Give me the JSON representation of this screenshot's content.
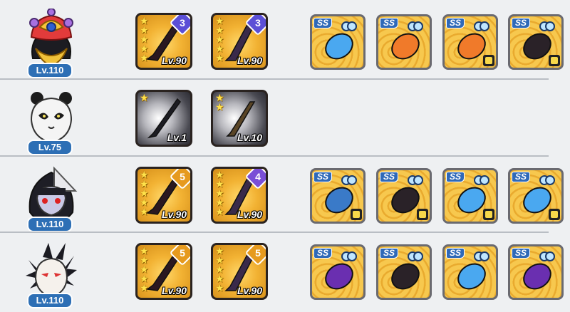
{
  "heroes": [
    {
      "name": "jester-hero",
      "level": "Lv.110",
      "weapons": [
        {
          "style": "gold",
          "stars": 5,
          "level": "Lv.90",
          "badge": "3",
          "badge_color": "#5b4fd6"
        },
        {
          "style": "gold",
          "stars": 5,
          "level": "Lv.90",
          "badge": "3",
          "badge_color": "#5b4fd6"
        }
      ],
      "equipment": [
        {
          "tier": "SS",
          "icon": "blue-drill-icon",
          "set_icon": false
        },
        {
          "tier": "SS",
          "icon": "fire-horn-icon",
          "set_icon": false
        },
        {
          "tier": "SS",
          "icon": "horn-bracer-icon",
          "set_icon": true
        },
        {
          "tier": "SS",
          "icon": "spiked-crown-icon",
          "set_icon": true
        }
      ]
    },
    {
      "name": "panda-hero",
      "level": "Lv.75",
      "weapons": [
        {
          "style": "grey",
          "stars": 1,
          "level": "Lv.1",
          "badge": "",
          "badge_color": ""
        },
        {
          "style": "grey",
          "stars": 2,
          "level": "Lv.10",
          "badge": "",
          "badge_color": ""
        }
      ],
      "equipment": []
    },
    {
      "name": "ninja-girl-hero",
      "level": "Lv.110",
      "weapons": [
        {
          "style": "gold",
          "stars": 5,
          "level": "Lv.90",
          "badge": "5",
          "badge_color": "#e69a1e"
        },
        {
          "style": "gold",
          "stars": 5,
          "level": "Lv.90",
          "badge": "4",
          "badge_color": "#7a4fd6"
        }
      ],
      "equipment": [
        {
          "tier": "SS",
          "icon": "fan-icon",
          "set_icon": true
        },
        {
          "tier": "SS",
          "icon": "dark-bracer-icon",
          "set_icon": true
        },
        {
          "tier": "SS",
          "icon": "mirror-icon",
          "set_icon": true
        },
        {
          "tier": "SS",
          "icon": "blue-drill-icon",
          "set_icon": true
        }
      ]
    },
    {
      "name": "fox-hero",
      "level": "Lv.110",
      "weapons": [
        {
          "style": "gold",
          "stars": 5,
          "level": "Lv.90",
          "badge": "5",
          "badge_color": "#e69a1e"
        },
        {
          "style": "gold",
          "stars": 5,
          "level": "Lv.90",
          "badge": "5",
          "badge_color": "#e69a1e"
        }
      ],
      "equipment": [
        {
          "tier": "SS",
          "icon": "purple-ring-icon",
          "set_icon": false
        },
        {
          "tier": "SS",
          "icon": "dark-vial-icon",
          "set_icon": false
        },
        {
          "tier": "SS",
          "icon": "blue-claw-icon",
          "set_icon": false
        },
        {
          "tier": "SS",
          "icon": "purple-dagger-icon",
          "set_icon": false
        }
      ]
    }
  ]
}
